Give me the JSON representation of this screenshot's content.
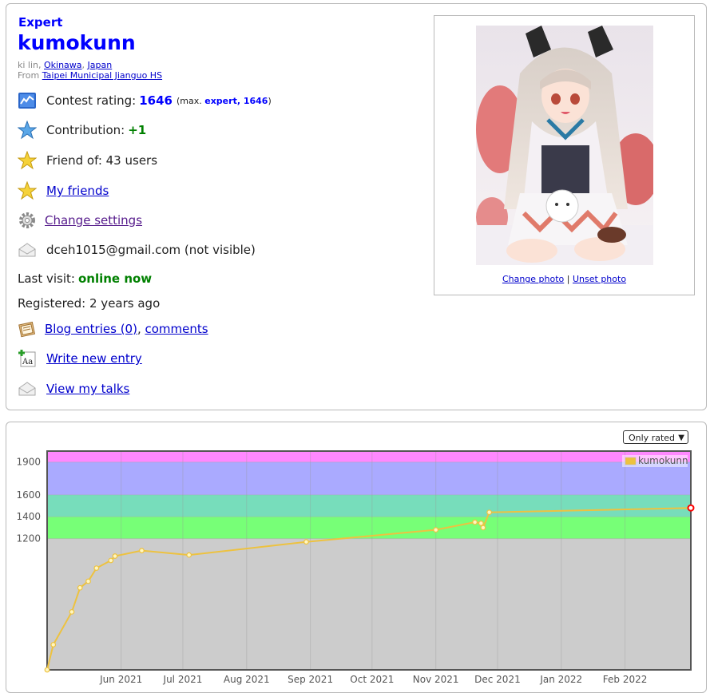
{
  "profile": {
    "rank": "Expert",
    "handle": "kumokunn",
    "name_prefix": "ki lin, ",
    "city": "Okinawa",
    "country": "Japan",
    "from_label": "From ",
    "organization": "Taipei Municipal Jianguo HS",
    "contest_rating_label": "Contest rating: ",
    "rating": "1646",
    "max_prefix": "(max. ",
    "max_rank": "expert",
    "max_rating": "1646",
    "max_suffix": ")",
    "contribution_label": "Contribution: ",
    "contribution": "+1",
    "friend_of": "Friend of: 43 users",
    "my_friends": "My friends",
    "change_settings": "Change settings",
    "email": "dceh1015@gmail.com (not visible)",
    "last_visit_label": "Last visit: ",
    "last_visit": "online now",
    "registered": "Registered: 2 years ago",
    "blog_entries": "Blog entries (0)",
    "comments": "comments",
    "write_new_entry": "Write new entry",
    "view_my_talks": "View my talks",
    "change_photo": "Change photo",
    "unset_photo": "Unset photo",
    "photo_sep": " | "
  },
  "filter": {
    "selected": "Only rated"
  },
  "chart_data": {
    "type": "line",
    "x_tick_labels": [
      "Jun 2021",
      "Jul 2021",
      "Aug 2021",
      "Sep 2021",
      "Oct 2021",
      "Nov 2021",
      "Dec 2021",
      "Jan 2022",
      "Feb 2022"
    ],
    "y_ticks": [
      1200,
      1400,
      1600,
      1900
    ],
    "ylim": [
      0,
      2000
    ],
    "xlim": [
      "2021-04-26",
      "2022-03-05"
    ],
    "grid": true,
    "legend": "top-right",
    "bands": [
      {
        "from": 0,
        "to": 1200,
        "color": "#cccccc"
      },
      {
        "from": 1200,
        "to": 1400,
        "color": "#77ff77"
      },
      {
        "from": 1400,
        "to": 1600,
        "color": "#77ddbb"
      },
      {
        "from": 1600,
        "to": 1900,
        "color": "#aaaaff"
      },
      {
        "from": 1900,
        "to": 2000,
        "color": "#ff88ff"
      }
    ],
    "series": [
      {
        "name": "kumokunn",
        "color": "#edc240",
        "points": [
          [
            "2021-04-26",
            0
          ],
          [
            "2021-04-29",
            230
          ],
          [
            "2021-05-08",
            530
          ],
          [
            "2021-05-12",
            750
          ],
          [
            "2021-05-16",
            810
          ],
          [
            "2021-05-20",
            930
          ],
          [
            "2021-05-27",
            1000
          ],
          [
            "2021-05-29",
            1040
          ],
          [
            "2021-06-11",
            1090
          ],
          [
            "2021-07-04",
            1050
          ],
          [
            "2021-08-30",
            1170
          ],
          [
            "2021-11-01",
            1280
          ],
          [
            "2021-11-20",
            1350
          ],
          [
            "2021-11-23",
            1340
          ],
          [
            "2021-11-24",
            1300
          ],
          [
            "2021-11-27",
            1440
          ],
          [
            "2022-03-05",
            1480
          ]
        ]
      }
    ]
  }
}
